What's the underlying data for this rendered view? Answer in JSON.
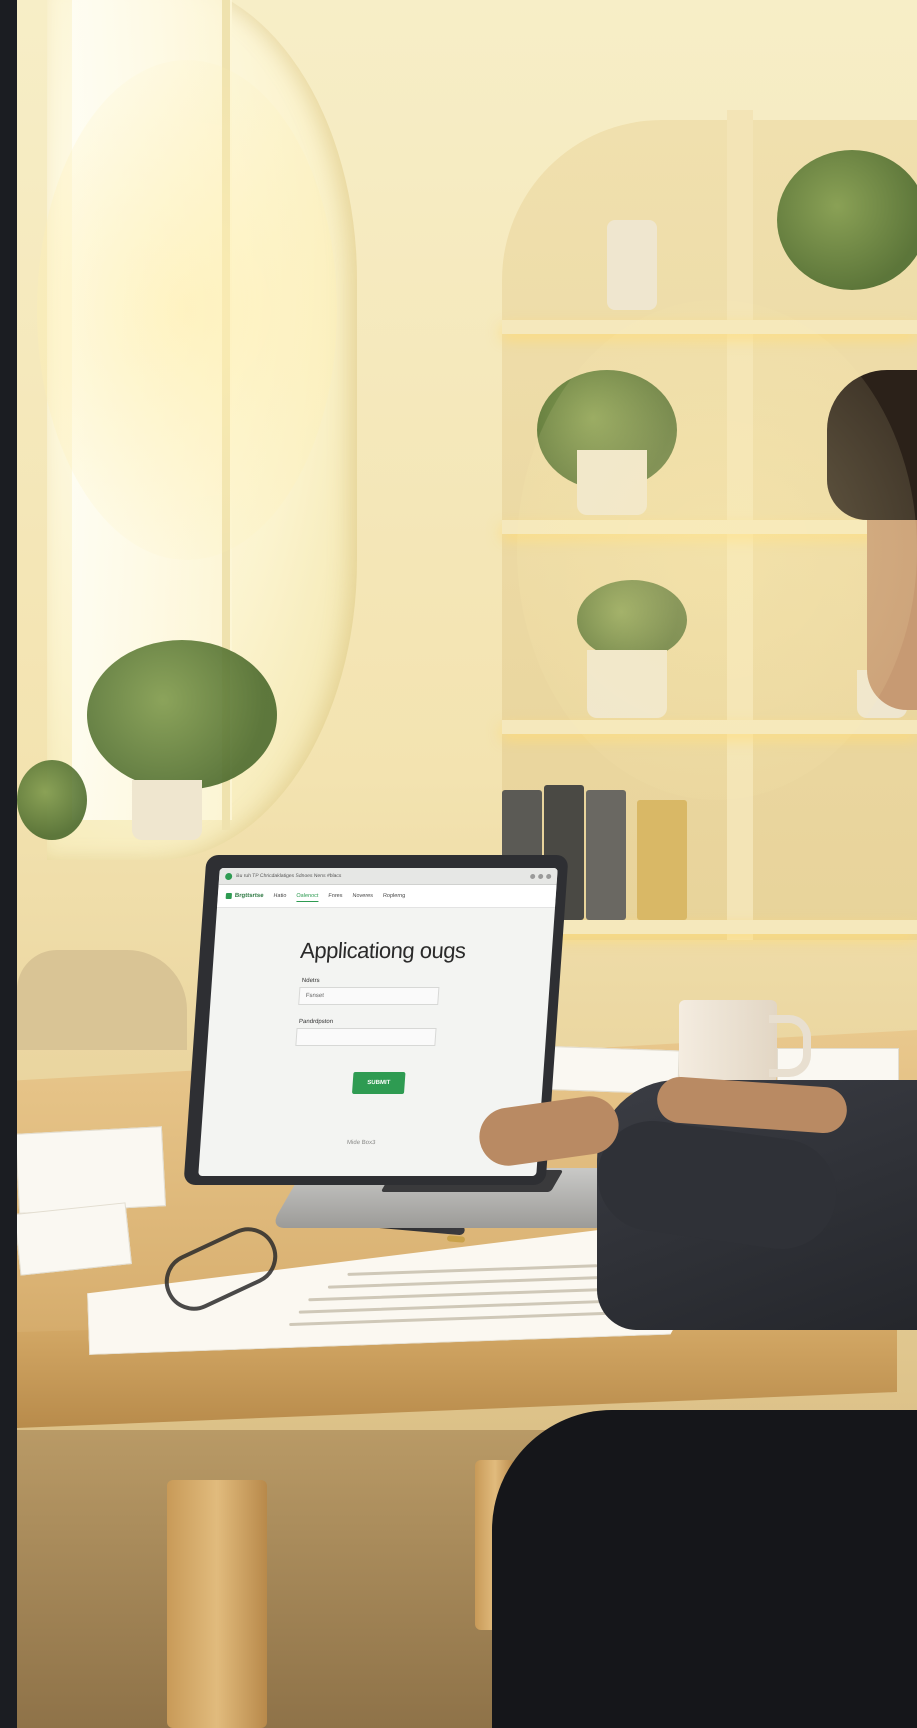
{
  "browser": {
    "tab_title": "Bu ruh TP Chricdaklatiges Sdnoes Nens  #blacs",
    "site_logo": "Brgttsrtse"
  },
  "nav": {
    "items": [
      "Hatio",
      "Oalenoct",
      "Fnres",
      "Noveres",
      "Roplerng"
    ],
    "active_index": 1
  },
  "form": {
    "title": "Applicationg ougs",
    "field1_label": "Ndetrs",
    "field1_value": "Fsnset",
    "field2_label": "Pandrdpston",
    "submit_label": "SUBMIT"
  },
  "laptop": {
    "brand_text": "Mide Box3"
  },
  "colors": {
    "accent_green": "#2e9b52",
    "warm_light": "#f7eec7",
    "desk_wood": "#dab273"
  }
}
